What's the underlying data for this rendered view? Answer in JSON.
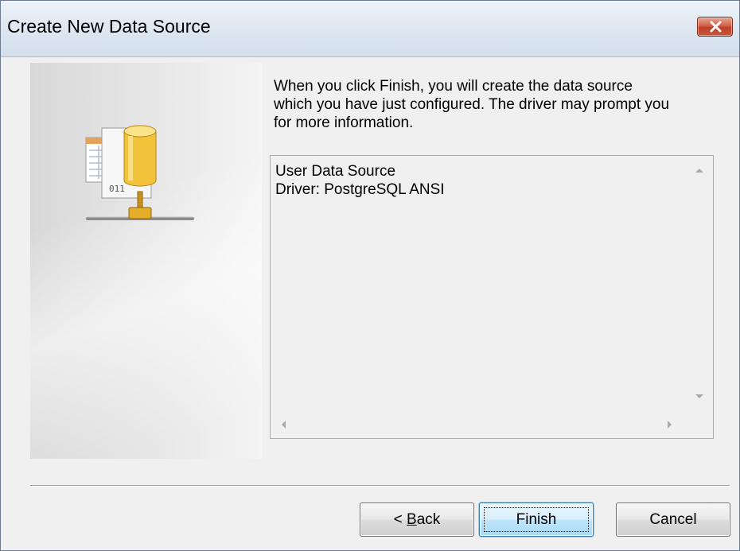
{
  "window": {
    "title": "Create New Data Source"
  },
  "message": {
    "line1": "When you click Finish, you will create the data source",
    "line2": "which you have just configured.  The driver may prompt you",
    "line3": "for more information."
  },
  "summary": {
    "line1": "User Data Source",
    "line2": "Driver:  PostgreSQL ANSI"
  },
  "icon": {
    "name": "database-icon",
    "file_label": "011"
  },
  "buttons": {
    "back_prefix": "< ",
    "back_mnemonic": "B",
    "back_rest": "ack",
    "finish": "Finish",
    "cancel": "Cancel"
  },
  "colors": {
    "close_button": "#c85a3e",
    "default_button_border": "#3c7fb1",
    "database_cylinder": "#f4c430"
  }
}
